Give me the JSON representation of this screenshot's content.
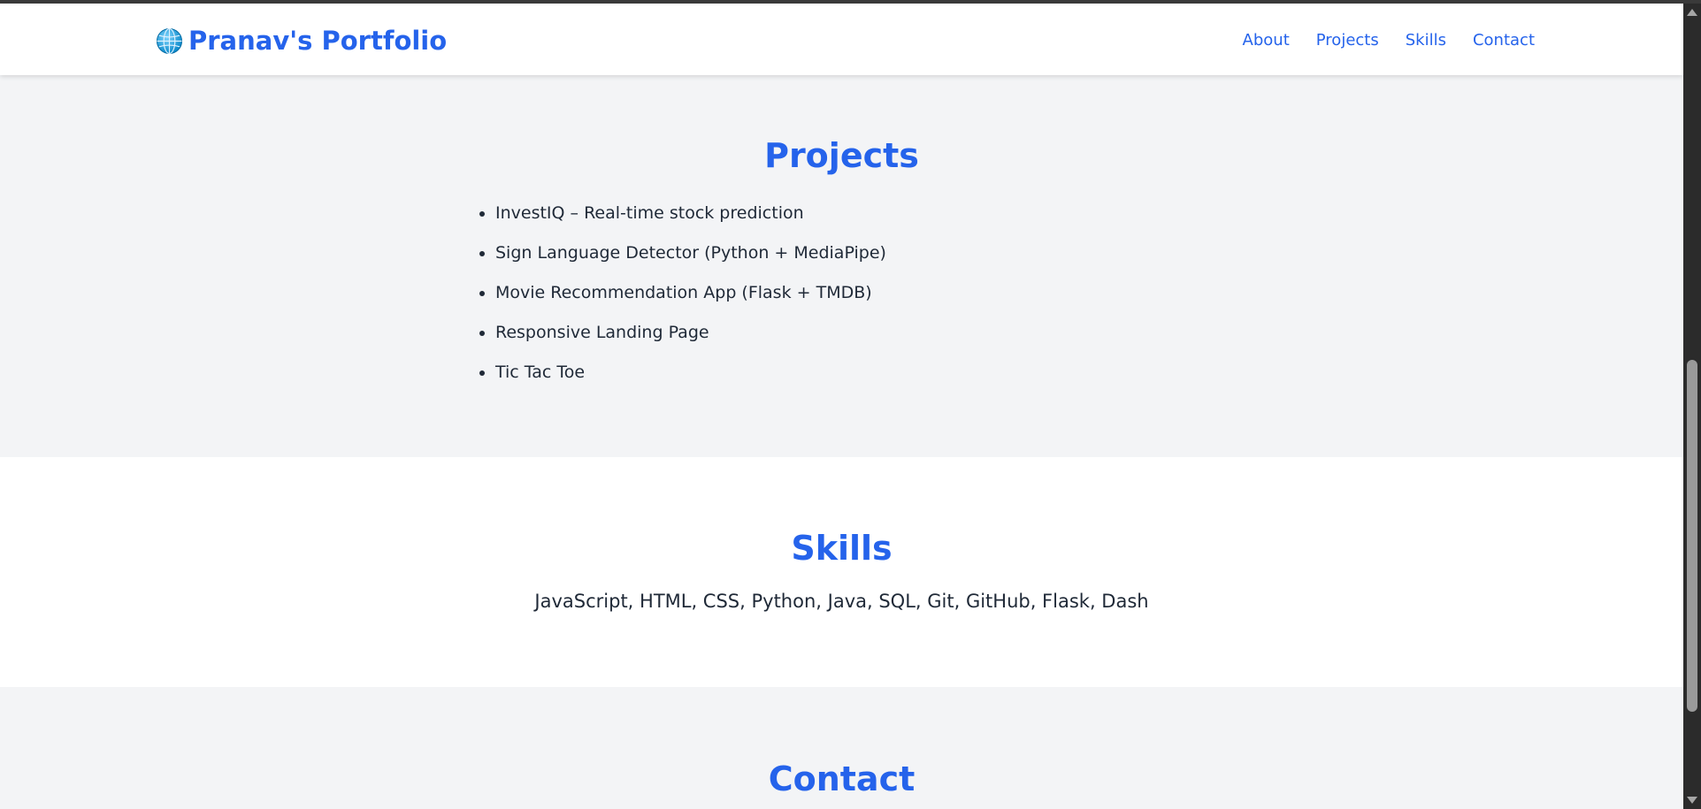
{
  "navbar": {
    "brand_icon": "globe-icon",
    "brand_title": "Pranav's Portfolio",
    "links": [
      {
        "label": "About"
      },
      {
        "label": "Projects"
      },
      {
        "label": "Skills"
      },
      {
        "label": "Contact"
      }
    ]
  },
  "projects": {
    "heading": "Projects",
    "items": [
      "InvestIQ – Real-time stock prediction",
      "Sign Language Detector (Python + MediaPipe)",
      "Movie Recommendation App (Flask + TMDB)",
      "Responsive Landing Page",
      "Tic Tac Toe"
    ]
  },
  "skills": {
    "heading": "Skills",
    "text": "JavaScript, HTML, CSS, Python, Java, SQL, Git, GitHub, Flask, Dash"
  },
  "contact": {
    "heading": "Contact"
  },
  "colors": {
    "accent": "#2563eb",
    "section_alt_bg": "#f3f4f6",
    "section_bg": "#ffffff",
    "text": "#1f2937"
  }
}
